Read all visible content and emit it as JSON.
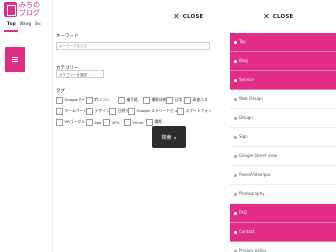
{
  "site": {
    "logo_text": "みちの\nブログ",
    "tabs": [
      "Top",
      "Blog",
      "Sc"
    ],
    "active_tab": "Top"
  },
  "search_overlay": {
    "close_label": "CLOSE",
    "keyword_label": "キーワード",
    "keyword_placeholder": "キーワードを入力",
    "category_label": "カテゴリー",
    "category_value": "カテゴリーを選択",
    "tags_label": "タグ",
    "tags": [
      [
        "Googleマイマップ",
        "パソコン",
        "複写紙",
        "撮影技術",
        "日用",
        "高速バス"
      ],
      [
        "ホームページ",
        "デザイン",
        "日帰り",
        "Google ストリートビュー",
        "",
        "スマートフォン"
      ],
      [
        "VRゴーグル",
        "ligo",
        "UFO",
        "Prime",
        "撮影"
      ]
    ],
    "search_button": "検索"
  },
  "drawer": {
    "close_label": "CLOSE",
    "items": [
      {
        "label": "Top",
        "highlight": true
      },
      {
        "label": "Blog",
        "highlight": true
      },
      {
        "label": "Service",
        "highlight": true
      },
      {
        "label": "Web Design",
        "highlight": false
      },
      {
        "label": "Design",
        "highlight": false
      },
      {
        "label": "Sign",
        "highlight": false
      },
      {
        "label": "Google Street view",
        "highlight": false
      },
      {
        "label": "Panel/Video/pas",
        "highlight": false
      },
      {
        "label": "Photography",
        "highlight": false
      },
      {
        "label": "FAQ",
        "highlight": true
      },
      {
        "label": "Contact",
        "highlight": true
      },
      {
        "label": "Privacy policy",
        "highlight": false
      }
    ]
  },
  "colors": {
    "accent": "#e22d84",
    "button_dark": "#2d2d2d"
  }
}
